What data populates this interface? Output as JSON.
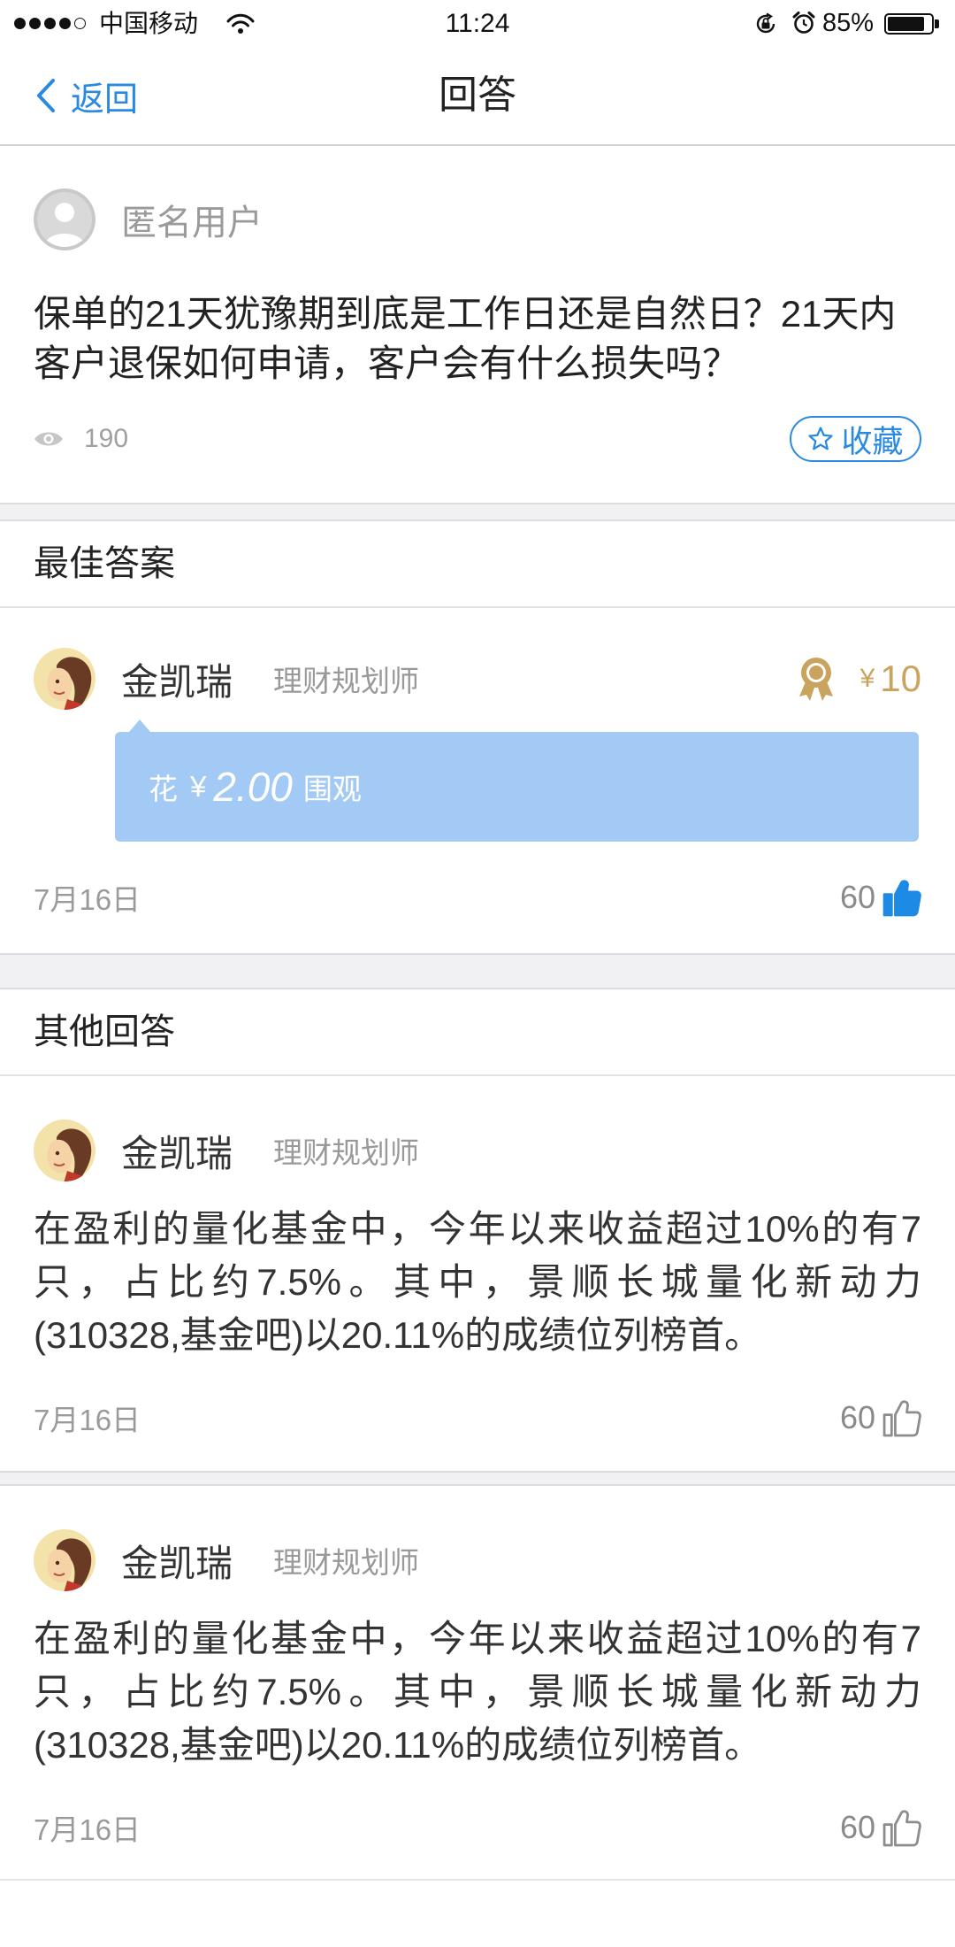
{
  "status_bar": {
    "signal_level": 4,
    "signal_max": 5,
    "carrier": "中国移动",
    "time": "11:24",
    "battery_text": "85%",
    "battery_level": 0.85,
    "icons": [
      "wifi-icon",
      "orientation-lock-icon",
      "alarm-icon",
      "battery-icon"
    ]
  },
  "nav": {
    "back_label": "返回",
    "title": "回答"
  },
  "question": {
    "user_name": "匿名用户",
    "text": "保单的21天犹豫期到底是工作日还是自然日？21天内客户退保如何申请，客户会有什么损失吗？",
    "views": "190",
    "favorite_label": "收藏"
  },
  "best_answer": {
    "section_title": "最佳答案",
    "author": "金凯瑞",
    "role": "理财规划师",
    "reward_currency": "¥",
    "reward_amount": "10",
    "paywall": {
      "prefix": "花",
      "currency": "¥",
      "amount": "2.00",
      "suffix": "围观"
    },
    "date": "7月16日",
    "likes": "60",
    "liked": true
  },
  "other_answers": {
    "section_title": "其他回答",
    "items": [
      {
        "author": "金凯瑞",
        "role": "理财规划师",
        "text": "在盈利的量化基金中，今年以来收益超过10%的有7只，占比约7.5%。其中，景顺长城量化新动力(310328,基金吧)以20.11%的成绩位列榜首。",
        "date": "7月16日",
        "likes": "60",
        "liked": false
      },
      {
        "author": "金凯瑞",
        "role": "理财规划师",
        "text": "在盈利的量化基金中，今年以来收益超过10%的有7只，占比约7.5%。其中，景顺长城量化新动力(310328,基金吧)以20.11%的成绩位列榜首。",
        "date": "7月16日",
        "likes": "60",
        "liked": false
      }
    ]
  },
  "colors": {
    "accent_blue": "#2a8ae2",
    "paywall_bg": "#a3caf4",
    "reward_gold": "#c9a45e",
    "like_active": "#1d8ae5",
    "muted_text": "#999999",
    "separator_bg": "#f1f1f3"
  }
}
